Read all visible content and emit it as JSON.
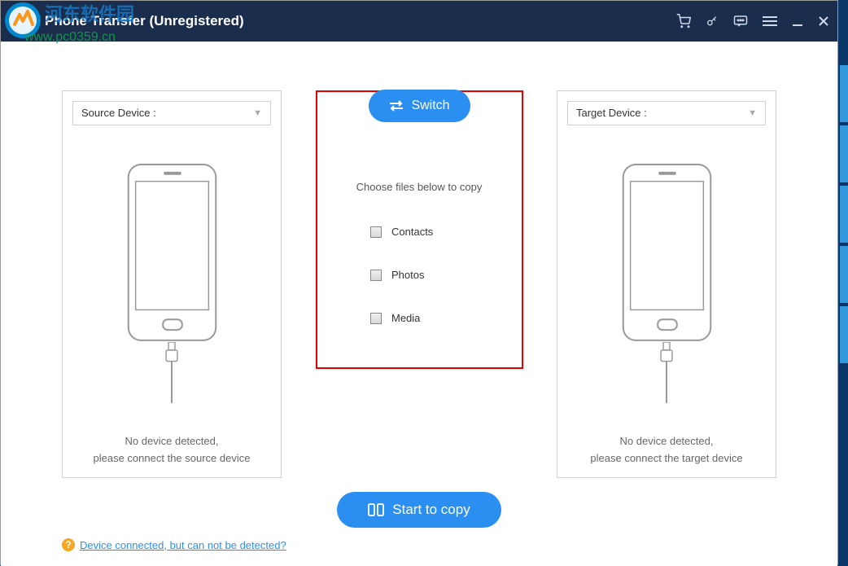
{
  "window": {
    "title": "Phone Transfer (Unregistered)"
  },
  "source": {
    "selectLabel": "Source Device :",
    "status1": "No device detected,",
    "status2": "please connect the source device"
  },
  "target": {
    "selectLabel": "Target Device :",
    "status1": "No device detected,",
    "status2": "please connect the target device"
  },
  "center": {
    "switchLabel": "Switch",
    "chooseLabel": "Choose files below to copy",
    "options": {
      "contacts": "Contacts",
      "photos": "Photos",
      "media": "Media"
    },
    "startLabel": "Start to copy"
  },
  "help": {
    "linkText": "Device connected, but can not be detected?"
  },
  "watermark": {
    "text1": "河东软件园",
    "text2": "www.pc0359.cn"
  }
}
